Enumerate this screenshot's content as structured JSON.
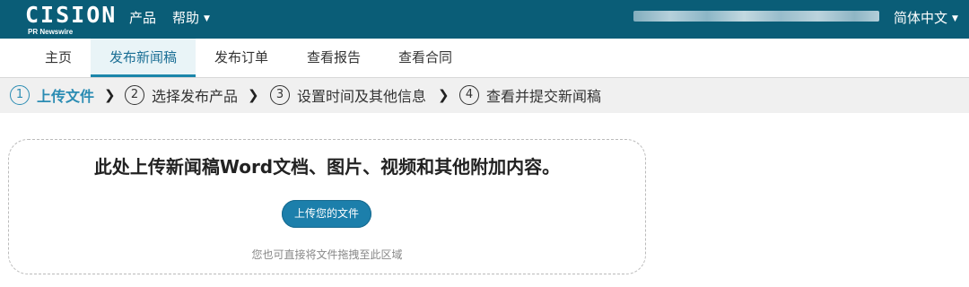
{
  "header": {
    "logo_main": "CISION",
    "logo_sub": "PR Newswire",
    "menu_products": "产品",
    "menu_help": "帮助",
    "help_caret": "▼",
    "language": "简体中文",
    "language_caret": "▼"
  },
  "nav": {
    "items": [
      {
        "label": "主页"
      },
      {
        "label": "发布新闻稿",
        "active": true
      },
      {
        "label": "发布订单"
      },
      {
        "label": "查看报告"
      },
      {
        "label": "查看合同"
      }
    ]
  },
  "steps": {
    "items": [
      {
        "num": "1",
        "label": "上传文件",
        "active": true
      },
      {
        "num": "2",
        "label": "选择发布产品"
      },
      {
        "num": "3",
        "label": "设置时间及其他信息"
      },
      {
        "num": "4",
        "label": "查看并提交新闻稿"
      }
    ],
    "arrow": "❯"
  },
  "upload": {
    "title": "此处上传新闻稿Word文档、图片、视频和其他附加内容。",
    "button_label": "上传您的文件",
    "hint": "您也可直接将文件拖拽至此区域"
  },
  "colors": {
    "header_bg": "#0a5d77",
    "accent": "#2b8cb3",
    "button_bg": "#1c7fab"
  }
}
